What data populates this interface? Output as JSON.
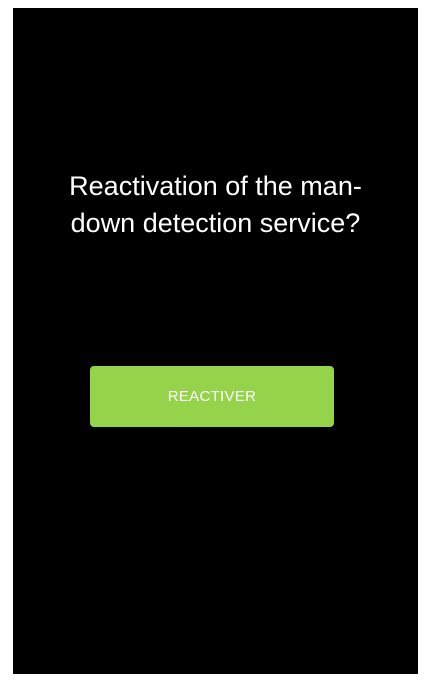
{
  "dialog": {
    "question_line1": "Reactivation of the man-",
    "question_line2": "down detection service?",
    "button_label": "REACTIVER"
  },
  "colors": {
    "background": "#000000",
    "button": "#95d34a",
    "text": "#ffffff"
  }
}
